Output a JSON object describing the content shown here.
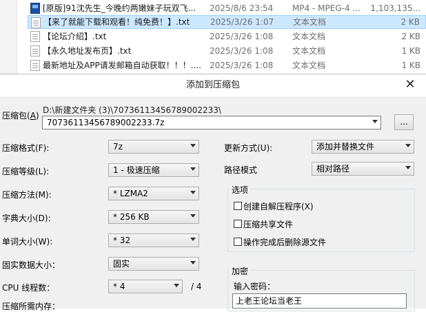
{
  "files": [
    {
      "name": "[原版]91沈先生_今晚约两嫩妹子玩双飞...",
      "date": "2025/8/6 23:54",
      "type": "MP4 - MPEG-4 ...",
      "size": "1,103,135...",
      "icon": "video-file-icon",
      "selected": false
    },
    {
      "name": "【来了就能下载和观看！纯免费！】.txt",
      "date": "2025/3/26 1:07",
      "type": "文本文档",
      "size": "2 KB",
      "icon": "text-file-icon",
      "selected": true
    },
    {
      "name": "【论坛介绍】.txt",
      "date": "2025/3/26 1:08",
      "type": "文本文档",
      "size": "2 KB",
      "icon": "text-file-icon",
      "selected": false
    },
    {
      "name": "【永久地址发布页】.txt",
      "date": "2025/3/26 1:08",
      "type": "文本文档",
      "size": "1 KB",
      "icon": "text-file-icon",
      "selected": false
    },
    {
      "name": "最新地址及APP请发邮箱自动获取！！！....",
      "date": "2025/3/26 1:08",
      "type": "文本文档",
      "size": "1 KB",
      "icon": "text-file-icon",
      "selected": false
    }
  ],
  "dialog": {
    "title": "添加到压缩包",
    "close_glyph": "✕",
    "archive_label": "压缩包(",
    "archive_hotkey": "A",
    "archive_label_end": ")",
    "archive_path": "D:\\新建文件夹 (3)\\707361134567890022​33\\",
    "archive_name": "7073611345678900223​3.7z",
    "browse_label": "...",
    "format_label": "压缩格式(F):",
    "format_value": "7z",
    "level_label": "压缩等级(L):",
    "level_value": "1 - 极速压缩",
    "method_label": "压缩方法(M):",
    "method_value": "* LZMA2",
    "dict_label": "字典大小(D):",
    "dict_value": "* 256 KB",
    "word_label": "单词大小(W):",
    "word_value": "* 32",
    "solid_label": "固实数据大小：",
    "solid_value": "固实",
    "cpu_label": "CPU 线程数：",
    "cpu_value": "* 4",
    "cpu_total": "/ 4",
    "memory_label": "压缩所需内存：",
    "update_label": "更新方式(U):",
    "update_value": "添加并替换文件",
    "path_label": "路径模式",
    "path_value": "相对路径",
    "options_title": "选项",
    "options": [
      {
        "label": "创建自解压程序(X)",
        "checked": false
      },
      {
        "label": "压缩共享文件",
        "checked": false
      },
      {
        "label": "操作完成后删除源文件",
        "checked": false
      }
    ],
    "encrypt_title": "加密",
    "password_label": "输入密码：",
    "password_value": "上老王论坛当老王"
  }
}
